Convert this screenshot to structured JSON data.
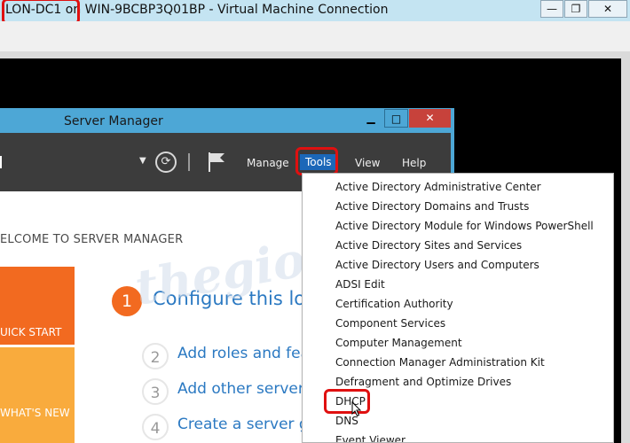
{
  "vm_window": {
    "title": "LON-DC1 on WIN-9BCBP3Q01BP - Virtual Machine Connection",
    "minimize": "—",
    "maximize": "❐",
    "close": "✕"
  },
  "server_manager": {
    "title": "Server Manager",
    "minimize": "▁",
    "maximize": "□",
    "close": "✕",
    "header": {
      "menus": {
        "manage": "Manage",
        "tools": "Tools",
        "view": "View",
        "help": "Help"
      },
      "refresh_icon": "refresh-icon",
      "flag_icon": "flag-icon",
      "dropdown_glyph": "▼",
      "refresh_glyph": "⟳"
    },
    "welcome": "ELCOME TO SERVER MANAGER",
    "tiles": {
      "quick_start": "UICK START",
      "whats_new": "WHAT'S NEW"
    },
    "steps": [
      {
        "num": "1",
        "text": "Configure this loc"
      },
      {
        "num": "2",
        "text": "Add roles and feat"
      },
      {
        "num": "3",
        "text": "Add other servers"
      },
      {
        "num": "4",
        "text": "Create a server gr"
      }
    ]
  },
  "tools_menu": {
    "items": [
      "Active Directory Administrative Center",
      "Active Directory Domains and Trusts",
      "Active Directory Module for Windows PowerShell",
      "Active Directory Sites and Services",
      "Active Directory Users and Computers",
      "ADSI Edit",
      "Certification Authority",
      "Component Services",
      "Computer Management",
      "Connection Manager Administration Kit",
      "Defragment and Optimize Drives",
      "DHCP",
      "DNS",
      "Event Viewer"
    ],
    "highlighted": "DHCP"
  },
  "watermark": "thegioimang",
  "colors": {
    "highlight_red": "#e01010",
    "tools_active": "#1c67b8",
    "quick_start_tile": "#f26a20",
    "whats_new_tile": "#f9ab3d",
    "link_blue": "#2b79c2"
  }
}
